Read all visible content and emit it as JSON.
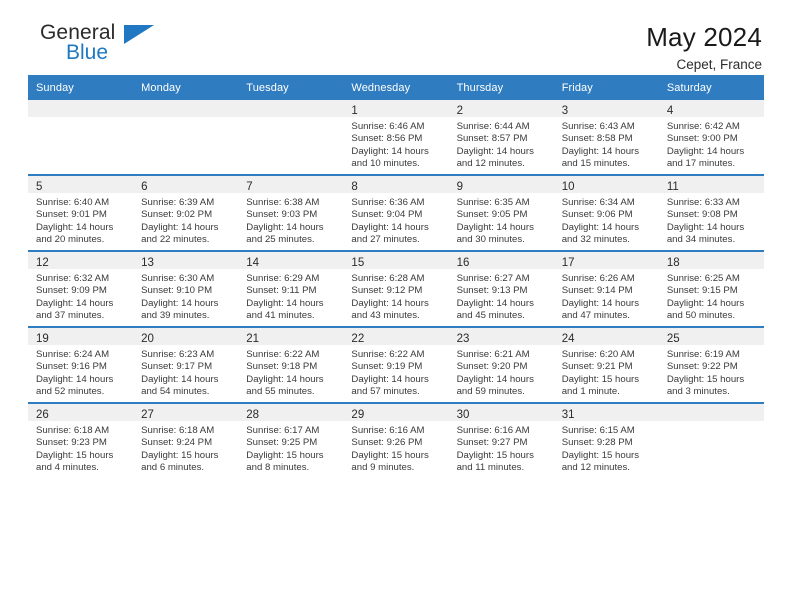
{
  "brand": {
    "name_top": "General",
    "name_bottom": "Blue",
    "accent_color": "#1f78c1"
  },
  "header": {
    "title": "May 2024",
    "subtitle": "Cepet, France"
  },
  "theme": {
    "header_blue": "#2f7cc0",
    "row_strip_gray": "#f0f0f0",
    "text": "#3a3a3a"
  },
  "labels": {
    "sunrise_prefix": "Sunrise:",
    "sunset_prefix": "Sunset:",
    "daylight_prefix": "Daylight:"
  },
  "weekday_headers": [
    "Sunday",
    "Monday",
    "Tuesday",
    "Wednesday",
    "Thursday",
    "Friday",
    "Saturday"
  ],
  "weeks": [
    [
      {
        "day": "",
        "empty": true
      },
      {
        "day": "",
        "empty": true
      },
      {
        "day": "",
        "empty": true
      },
      {
        "day": "1",
        "sunrise": "Sunrise: 6:46 AM",
        "sunset": "Sunset: 8:56 PM",
        "daylight_1": "Daylight: 14 hours",
        "daylight_2": "and 10 minutes."
      },
      {
        "day": "2",
        "sunrise": "Sunrise: 6:44 AM",
        "sunset": "Sunset: 8:57 PM",
        "daylight_1": "Daylight: 14 hours",
        "daylight_2": "and 12 minutes."
      },
      {
        "day": "3",
        "sunrise": "Sunrise: 6:43 AM",
        "sunset": "Sunset: 8:58 PM",
        "daylight_1": "Daylight: 14 hours",
        "daylight_2": "and 15 minutes."
      },
      {
        "day": "4",
        "sunrise": "Sunrise: 6:42 AM",
        "sunset": "Sunset: 9:00 PM",
        "daylight_1": "Daylight: 14 hours",
        "daylight_2": "and 17 minutes."
      }
    ],
    [
      {
        "day": "5",
        "sunrise": "Sunrise: 6:40 AM",
        "sunset": "Sunset: 9:01 PM",
        "daylight_1": "Daylight: 14 hours",
        "daylight_2": "and 20 minutes."
      },
      {
        "day": "6",
        "sunrise": "Sunrise: 6:39 AM",
        "sunset": "Sunset: 9:02 PM",
        "daylight_1": "Daylight: 14 hours",
        "daylight_2": "and 22 minutes."
      },
      {
        "day": "7",
        "sunrise": "Sunrise: 6:38 AM",
        "sunset": "Sunset: 9:03 PM",
        "daylight_1": "Daylight: 14 hours",
        "daylight_2": "and 25 minutes."
      },
      {
        "day": "8",
        "sunrise": "Sunrise: 6:36 AM",
        "sunset": "Sunset: 9:04 PM",
        "daylight_1": "Daylight: 14 hours",
        "daylight_2": "and 27 minutes."
      },
      {
        "day": "9",
        "sunrise": "Sunrise: 6:35 AM",
        "sunset": "Sunset: 9:05 PM",
        "daylight_1": "Daylight: 14 hours",
        "daylight_2": "and 30 minutes."
      },
      {
        "day": "10",
        "sunrise": "Sunrise: 6:34 AM",
        "sunset": "Sunset: 9:06 PM",
        "daylight_1": "Daylight: 14 hours",
        "daylight_2": "and 32 minutes."
      },
      {
        "day": "11",
        "sunrise": "Sunrise: 6:33 AM",
        "sunset": "Sunset: 9:08 PM",
        "daylight_1": "Daylight: 14 hours",
        "daylight_2": "and 34 minutes."
      }
    ],
    [
      {
        "day": "12",
        "sunrise": "Sunrise: 6:32 AM",
        "sunset": "Sunset: 9:09 PM",
        "daylight_1": "Daylight: 14 hours",
        "daylight_2": "and 37 minutes."
      },
      {
        "day": "13",
        "sunrise": "Sunrise: 6:30 AM",
        "sunset": "Sunset: 9:10 PM",
        "daylight_1": "Daylight: 14 hours",
        "daylight_2": "and 39 minutes."
      },
      {
        "day": "14",
        "sunrise": "Sunrise: 6:29 AM",
        "sunset": "Sunset: 9:11 PM",
        "daylight_1": "Daylight: 14 hours",
        "daylight_2": "and 41 minutes."
      },
      {
        "day": "15",
        "sunrise": "Sunrise: 6:28 AM",
        "sunset": "Sunset: 9:12 PM",
        "daylight_1": "Daylight: 14 hours",
        "daylight_2": "and 43 minutes."
      },
      {
        "day": "16",
        "sunrise": "Sunrise: 6:27 AM",
        "sunset": "Sunset: 9:13 PM",
        "daylight_1": "Daylight: 14 hours",
        "daylight_2": "and 45 minutes."
      },
      {
        "day": "17",
        "sunrise": "Sunrise: 6:26 AM",
        "sunset": "Sunset: 9:14 PM",
        "daylight_1": "Daylight: 14 hours",
        "daylight_2": "and 47 minutes."
      },
      {
        "day": "18",
        "sunrise": "Sunrise: 6:25 AM",
        "sunset": "Sunset: 9:15 PM",
        "daylight_1": "Daylight: 14 hours",
        "daylight_2": "and 50 minutes."
      }
    ],
    [
      {
        "day": "19",
        "sunrise": "Sunrise: 6:24 AM",
        "sunset": "Sunset: 9:16 PM",
        "daylight_1": "Daylight: 14 hours",
        "daylight_2": "and 52 minutes."
      },
      {
        "day": "20",
        "sunrise": "Sunrise: 6:23 AM",
        "sunset": "Sunset: 9:17 PM",
        "daylight_1": "Daylight: 14 hours",
        "daylight_2": "and 54 minutes."
      },
      {
        "day": "21",
        "sunrise": "Sunrise: 6:22 AM",
        "sunset": "Sunset: 9:18 PM",
        "daylight_1": "Daylight: 14 hours",
        "daylight_2": "and 55 minutes."
      },
      {
        "day": "22",
        "sunrise": "Sunrise: 6:22 AM",
        "sunset": "Sunset: 9:19 PM",
        "daylight_1": "Daylight: 14 hours",
        "daylight_2": "and 57 minutes."
      },
      {
        "day": "23",
        "sunrise": "Sunrise: 6:21 AM",
        "sunset": "Sunset: 9:20 PM",
        "daylight_1": "Daylight: 14 hours",
        "daylight_2": "and 59 minutes."
      },
      {
        "day": "24",
        "sunrise": "Sunrise: 6:20 AM",
        "sunset": "Sunset: 9:21 PM",
        "daylight_1": "Daylight: 15 hours",
        "daylight_2": "and 1 minute."
      },
      {
        "day": "25",
        "sunrise": "Sunrise: 6:19 AM",
        "sunset": "Sunset: 9:22 PM",
        "daylight_1": "Daylight: 15 hours",
        "daylight_2": "and 3 minutes."
      }
    ],
    [
      {
        "day": "26",
        "sunrise": "Sunrise: 6:18 AM",
        "sunset": "Sunset: 9:23 PM",
        "daylight_1": "Daylight: 15 hours",
        "daylight_2": "and 4 minutes."
      },
      {
        "day": "27",
        "sunrise": "Sunrise: 6:18 AM",
        "sunset": "Sunset: 9:24 PM",
        "daylight_1": "Daylight: 15 hours",
        "daylight_2": "and 6 minutes."
      },
      {
        "day": "28",
        "sunrise": "Sunrise: 6:17 AM",
        "sunset": "Sunset: 9:25 PM",
        "daylight_1": "Daylight: 15 hours",
        "daylight_2": "and 8 minutes."
      },
      {
        "day": "29",
        "sunrise": "Sunrise: 6:16 AM",
        "sunset": "Sunset: 9:26 PM",
        "daylight_1": "Daylight: 15 hours",
        "daylight_2": "and 9 minutes."
      },
      {
        "day": "30",
        "sunrise": "Sunrise: 6:16 AM",
        "sunset": "Sunset: 9:27 PM",
        "daylight_1": "Daylight: 15 hours",
        "daylight_2": "and 11 minutes."
      },
      {
        "day": "31",
        "sunrise": "Sunrise: 6:15 AM",
        "sunset": "Sunset: 9:28 PM",
        "daylight_1": "Daylight: 15 hours",
        "daylight_2": "and 12 minutes."
      },
      {
        "day": "",
        "empty": true
      }
    ]
  ]
}
